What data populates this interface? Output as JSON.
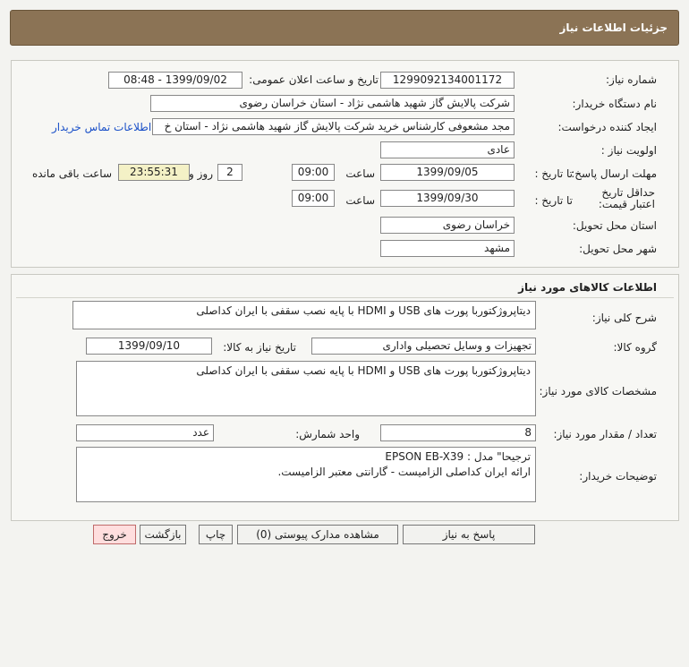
{
  "header": {
    "title": "جزئیات اطلاعات نیاز"
  },
  "info": {
    "need_number_label": "شماره نیاز:",
    "need_number": "1299092134001172",
    "announce_label": "تاریخ و ساعت اعلان عمومی:",
    "announce_value": "1399/09/02 - 08:48",
    "buyer_label": "نام دستگاه خریدار:",
    "buyer_value": "شرکت پالایش گاز شهید هاشمی نژاد - استان خراسان رضوی",
    "creator_label": "ایجاد کننده درخواست:",
    "creator_value": "مجد مشعوفی کارشناس خرید شرکت پالایش گاز شهید هاشمی نژاد - استان خ",
    "contact_link": "اطلاعات تماس خریدار",
    "priority_label": "اولویت نیاز :",
    "priority_value": "عادی",
    "deadline_label": "مهلت ارسال پاسخ:",
    "to_date_label": "تا تاریخ :",
    "deadline_date": "1399/09/05",
    "time_label": "ساعت",
    "deadline_time": "09:00",
    "days_value": "2",
    "days_label": "روز و",
    "remaining_time": "23:55:31",
    "remaining_label": "ساعت باقی مانده",
    "validity_label": "حداقل تاریخ اعتبار قیمت:",
    "validity_date": "1399/09/30",
    "validity_time": "09:00",
    "province_label": "استان محل تحویل:",
    "province_value": "خراسان رضوی",
    "city_label": "شهر محل تحویل:",
    "city_value": "مشهد"
  },
  "goods": {
    "title": "اطلاعات کالاهای مورد نیاز",
    "summary_label": "شرح کلی نیاز:",
    "summary_value": "دیتاپروژکتوربا پورت های USB و HDMI با پایه نصب سقفی با ایران کداصلی",
    "group_label": "گروه کالا:",
    "group_value": "تجهیزات و وسایل تحصیلی واداری",
    "need_date_label": "تاریخ نیاز به کالا:",
    "need_date_value": "1399/09/10",
    "specs_label": "مشخصات کالای مورد نیاز:",
    "specs_value": "دیتاپروژکتوربا پورت های USB و HDMI با پایه نصب سقفی با ایران کداصلی",
    "qty_label": "تعداد / مقدار مورد نیاز:",
    "qty_value": "8",
    "unit_label": "واحد شمارش:",
    "unit_value": "عدد",
    "notes_label": "توضیحات خریدار:",
    "notes_value": "ترجیحا\" مدل : EPSON EB-X39\nارائه ایران کداصلی الزامیست - گارانتی معتبر الزامیست."
  },
  "buttons": {
    "respond": "پاسخ به نیاز",
    "attachments": "مشاهده مدارک پیوستی (0)",
    "print": "چاپ",
    "back": "بازگشت",
    "exit": "خروج"
  }
}
